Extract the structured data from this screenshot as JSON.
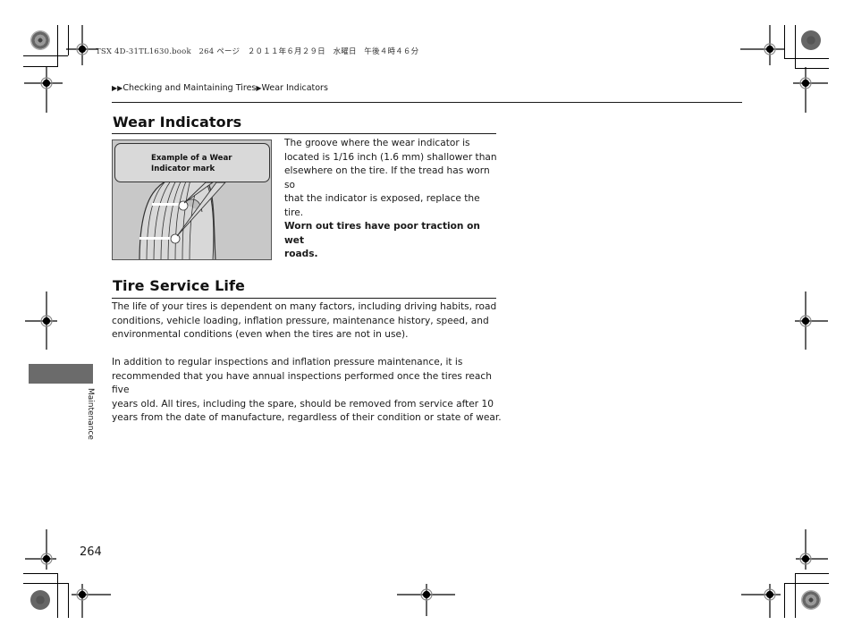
{
  "print_header": "TSX 4D-31TL1630.book   264 ページ   ２０１１年６月２９日   水曜日   午後４時４６分",
  "breadcrumb": {
    "prefix_icon": "double-arrow-right",
    "items": [
      "Checking and Maintaining Tires",
      "Wear Indicators"
    ]
  },
  "sections": [
    {
      "title": "Wear Indicators",
      "figure": {
        "callout": "Example of a Wear Indicator mark",
        "callout_line1": "Example of a Wear",
        "callout_line2": "Indicator mark"
      },
      "paragraph_lines": [
        "The groove where the wear indicator is",
        "located is 1/16 inch (1.6 mm) shallower than",
        "elsewhere on the tire. If the tread has worn so",
        "that the indicator is exposed, replace the tire."
      ],
      "bold_lines": [
        "Worn out tires have poor traction on wet",
        "roads."
      ]
    },
    {
      "title": "Tire Service Life",
      "paragraph1_lines": [
        "The life of your tires is dependent on many factors, including driving habits, road",
        "conditions, vehicle loading, inflation pressure, maintenance history, speed, and",
        "environmental conditions (even when the tires are not in use)."
      ],
      "paragraph2_lines": [
        "In addition to regular inspections and inflation pressure maintenance, it is",
        "recommended that you have annual inspections performed once the tires reach five",
        "years old. All tires, including the spare, should be removed from service after 10",
        "years from the date of manufacture, regardless of their condition or state of wear."
      ]
    }
  ],
  "side_tab": {
    "label": "Maintenance",
    "color": "#6b6b6b"
  },
  "page_number": "264"
}
